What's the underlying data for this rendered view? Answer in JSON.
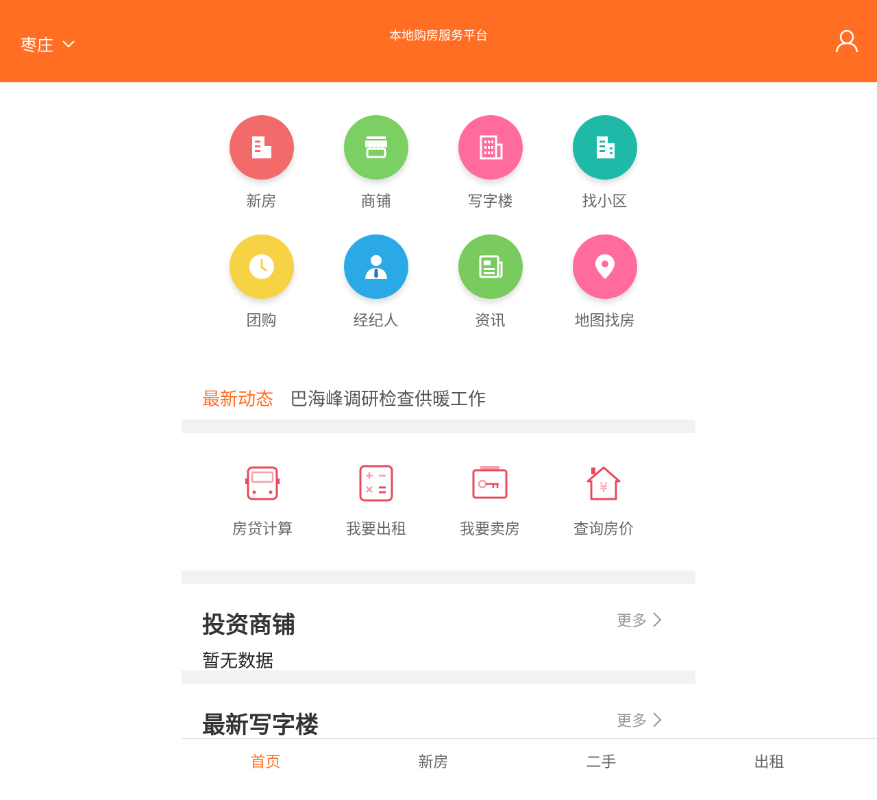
{
  "header": {
    "city": "枣庄",
    "title": "本地购房服务平台"
  },
  "categories": [
    {
      "label": "新房",
      "icon": "building-icon",
      "color": "#f26a6a"
    },
    {
      "label": "商铺",
      "icon": "shop-icon",
      "color": "#7ccf63"
    },
    {
      "label": "写字楼",
      "icon": "office-building-icon",
      "color": "#ff6b9a"
    },
    {
      "label": "找小区",
      "icon": "community-icon",
      "color": "#1fb9a8"
    },
    {
      "label": "团购",
      "icon": "clock-icon",
      "color": "#f6d244"
    },
    {
      "label": "经纪人",
      "icon": "agent-icon",
      "color": "#2aa9e6"
    },
    {
      "label": "资讯",
      "icon": "news-icon",
      "color": "#79cb5e"
    },
    {
      "label": "地图找房",
      "icon": "map-pin-icon",
      "color": "#ff6b9a"
    }
  ],
  "news": {
    "tag": "最新动态",
    "headline": "巴海峰调研检查供暖工作"
  },
  "tools": [
    {
      "label": "房贷计算",
      "icon": "bus-calculator-icon"
    },
    {
      "label": "我要出租",
      "icon": "calculator-icon"
    },
    {
      "label": "我要卖房",
      "icon": "key-icon"
    },
    {
      "label": "查询房价",
      "icon": "house-price-icon"
    }
  ],
  "sections": {
    "shops": {
      "title": "投资商铺",
      "more": "更多",
      "empty": "暂无数据"
    },
    "offices": {
      "title": "最新写字楼",
      "more": "更多"
    }
  },
  "tabbar": [
    "首页",
    "新房",
    "二手",
    "出租"
  ],
  "colors": {
    "accent": "#ff6e22",
    "tool_icon": "#e84c5c"
  }
}
